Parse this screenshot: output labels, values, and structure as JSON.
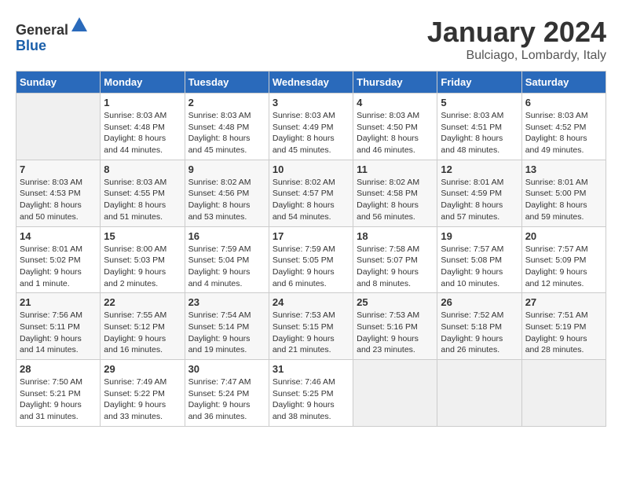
{
  "header": {
    "logo_line1": "General",
    "logo_line2": "Blue",
    "month_year": "January 2024",
    "location": "Bulciago, Lombardy, Italy"
  },
  "days_of_week": [
    "Sunday",
    "Monday",
    "Tuesday",
    "Wednesday",
    "Thursday",
    "Friday",
    "Saturday"
  ],
  "weeks": [
    [
      {
        "day": "",
        "info": ""
      },
      {
        "day": "1",
        "info": "Sunrise: 8:03 AM\nSunset: 4:48 PM\nDaylight: 8 hours\nand 44 minutes."
      },
      {
        "day": "2",
        "info": "Sunrise: 8:03 AM\nSunset: 4:48 PM\nDaylight: 8 hours\nand 45 minutes."
      },
      {
        "day": "3",
        "info": "Sunrise: 8:03 AM\nSunset: 4:49 PM\nDaylight: 8 hours\nand 45 minutes."
      },
      {
        "day": "4",
        "info": "Sunrise: 8:03 AM\nSunset: 4:50 PM\nDaylight: 8 hours\nand 46 minutes."
      },
      {
        "day": "5",
        "info": "Sunrise: 8:03 AM\nSunset: 4:51 PM\nDaylight: 8 hours\nand 48 minutes."
      },
      {
        "day": "6",
        "info": "Sunrise: 8:03 AM\nSunset: 4:52 PM\nDaylight: 8 hours\nand 49 minutes."
      }
    ],
    [
      {
        "day": "7",
        "info": "Sunrise: 8:03 AM\nSunset: 4:53 PM\nDaylight: 8 hours\nand 50 minutes."
      },
      {
        "day": "8",
        "info": "Sunrise: 8:03 AM\nSunset: 4:55 PM\nDaylight: 8 hours\nand 51 minutes."
      },
      {
        "day": "9",
        "info": "Sunrise: 8:02 AM\nSunset: 4:56 PM\nDaylight: 8 hours\nand 53 minutes."
      },
      {
        "day": "10",
        "info": "Sunrise: 8:02 AM\nSunset: 4:57 PM\nDaylight: 8 hours\nand 54 minutes."
      },
      {
        "day": "11",
        "info": "Sunrise: 8:02 AM\nSunset: 4:58 PM\nDaylight: 8 hours\nand 56 minutes."
      },
      {
        "day": "12",
        "info": "Sunrise: 8:01 AM\nSunset: 4:59 PM\nDaylight: 8 hours\nand 57 minutes."
      },
      {
        "day": "13",
        "info": "Sunrise: 8:01 AM\nSunset: 5:00 PM\nDaylight: 8 hours\nand 59 minutes."
      }
    ],
    [
      {
        "day": "14",
        "info": "Sunrise: 8:01 AM\nSunset: 5:02 PM\nDaylight: 9 hours\nand 1 minute."
      },
      {
        "day": "15",
        "info": "Sunrise: 8:00 AM\nSunset: 5:03 PM\nDaylight: 9 hours\nand 2 minutes."
      },
      {
        "day": "16",
        "info": "Sunrise: 7:59 AM\nSunset: 5:04 PM\nDaylight: 9 hours\nand 4 minutes."
      },
      {
        "day": "17",
        "info": "Sunrise: 7:59 AM\nSunset: 5:05 PM\nDaylight: 9 hours\nand 6 minutes."
      },
      {
        "day": "18",
        "info": "Sunrise: 7:58 AM\nSunset: 5:07 PM\nDaylight: 9 hours\nand 8 minutes."
      },
      {
        "day": "19",
        "info": "Sunrise: 7:57 AM\nSunset: 5:08 PM\nDaylight: 9 hours\nand 10 minutes."
      },
      {
        "day": "20",
        "info": "Sunrise: 7:57 AM\nSunset: 5:09 PM\nDaylight: 9 hours\nand 12 minutes."
      }
    ],
    [
      {
        "day": "21",
        "info": "Sunrise: 7:56 AM\nSunset: 5:11 PM\nDaylight: 9 hours\nand 14 minutes."
      },
      {
        "day": "22",
        "info": "Sunrise: 7:55 AM\nSunset: 5:12 PM\nDaylight: 9 hours\nand 16 minutes."
      },
      {
        "day": "23",
        "info": "Sunrise: 7:54 AM\nSunset: 5:14 PM\nDaylight: 9 hours\nand 19 minutes."
      },
      {
        "day": "24",
        "info": "Sunrise: 7:53 AM\nSunset: 5:15 PM\nDaylight: 9 hours\nand 21 minutes."
      },
      {
        "day": "25",
        "info": "Sunrise: 7:53 AM\nSunset: 5:16 PM\nDaylight: 9 hours\nand 23 minutes."
      },
      {
        "day": "26",
        "info": "Sunrise: 7:52 AM\nSunset: 5:18 PM\nDaylight: 9 hours\nand 26 minutes."
      },
      {
        "day": "27",
        "info": "Sunrise: 7:51 AM\nSunset: 5:19 PM\nDaylight: 9 hours\nand 28 minutes."
      }
    ],
    [
      {
        "day": "28",
        "info": "Sunrise: 7:50 AM\nSunset: 5:21 PM\nDaylight: 9 hours\nand 31 minutes."
      },
      {
        "day": "29",
        "info": "Sunrise: 7:49 AM\nSunset: 5:22 PM\nDaylight: 9 hours\nand 33 minutes."
      },
      {
        "day": "30",
        "info": "Sunrise: 7:47 AM\nSunset: 5:24 PM\nDaylight: 9 hours\nand 36 minutes."
      },
      {
        "day": "31",
        "info": "Sunrise: 7:46 AM\nSunset: 5:25 PM\nDaylight: 9 hours\nand 38 minutes."
      },
      {
        "day": "",
        "info": ""
      },
      {
        "day": "",
        "info": ""
      },
      {
        "day": "",
        "info": ""
      }
    ]
  ]
}
